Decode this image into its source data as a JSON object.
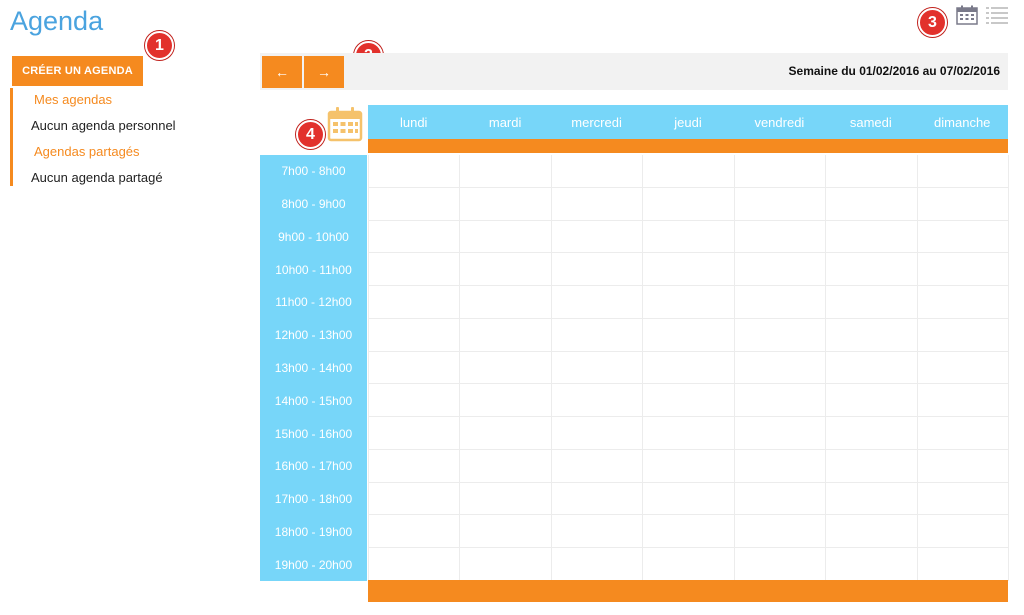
{
  "app": {
    "title": "Agenda"
  },
  "badges": [
    "1",
    "2",
    "3",
    "4"
  ],
  "sidebar": {
    "create_label": "CRÉER UN AGENDA",
    "my_agendas_label": "Mes agendas",
    "my_agendas_empty": "Aucun agenda personnel",
    "shared_agendas_label": "Agendas partagés",
    "shared_agendas_empty": "Aucun agenda partagé"
  },
  "nav": {
    "prev_label": "←",
    "next_label": "→",
    "week_label": "Semaine du 01/02/2016 au 07/02/2016"
  },
  "days": [
    "lundi",
    "mardi",
    "mercredi",
    "jeudi",
    "vendredi",
    "samedi",
    "dimanche"
  ],
  "time_slots": [
    "7h00 - 8h00",
    "8h00 - 9h00",
    "9h00 - 10h00",
    "10h00 - 11h00",
    "11h00 - 12h00",
    "12h00 - 13h00",
    "13h00 - 14h00",
    "14h00 - 15h00",
    "15h00 - 16h00",
    "16h00 - 17h00",
    "17h00 - 18h00",
    "18h00 - 19h00",
    "19h00 - 20h00"
  ],
  "icons": {
    "calendar_view": "calendar-icon",
    "list_view": "list-icon",
    "grid_calendar": "calendar-icon"
  },
  "colors": {
    "accent": "#f58a1f",
    "header_blue": "#77d6f9",
    "title_blue": "#4aa3df",
    "badge_red": "#e2312c"
  }
}
